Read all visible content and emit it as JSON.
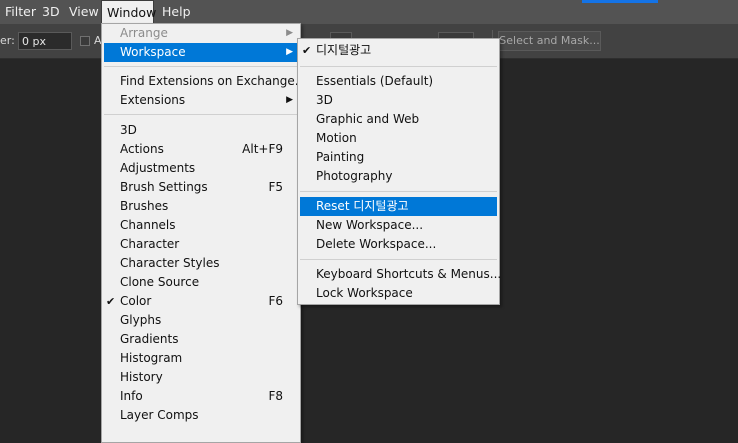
{
  "menubar": {
    "items": [
      "Filter",
      "3D",
      "View",
      "Window",
      "Help"
    ]
  },
  "options": {
    "feather_label": "er:",
    "feather_value": "0 px",
    "aa_label": "A",
    "select_mask_label": "Select and Mask..."
  },
  "window_menu": {
    "items": [
      {
        "label": "Arrange",
        "submenu": true,
        "disabled": true
      },
      {
        "label": "Workspace",
        "submenu": true,
        "highlighted": true
      },
      {
        "label": "Find Extensions on Exchange..."
      },
      {
        "label": "Extensions",
        "submenu": true
      },
      {
        "label": "3D"
      },
      {
        "label": "Actions",
        "shortcut": "Alt+F9"
      },
      {
        "label": "Adjustments"
      },
      {
        "label": "Brush Settings",
        "shortcut": "F5"
      },
      {
        "label": "Brushes"
      },
      {
        "label": "Channels"
      },
      {
        "label": "Character"
      },
      {
        "label": "Character Styles"
      },
      {
        "label": "Clone Source"
      },
      {
        "label": "Color",
        "shortcut": "F6",
        "checked": true
      },
      {
        "label": "Glyphs"
      },
      {
        "label": "Gradients"
      },
      {
        "label": "Histogram"
      },
      {
        "label": "History"
      },
      {
        "label": "Info",
        "shortcut": "F8"
      },
      {
        "label": "Layer Comps"
      }
    ]
  },
  "workspace_menu": {
    "items": [
      {
        "label": "디지털광고",
        "checked": true
      },
      {
        "label": "Essentials (Default)"
      },
      {
        "label": "3D"
      },
      {
        "label": "Graphic and Web"
      },
      {
        "label": "Motion"
      },
      {
        "label": "Painting"
      },
      {
        "label": "Photography"
      },
      {
        "label": "Reset 디지털광고",
        "highlighted": true
      },
      {
        "label": "New Workspace..."
      },
      {
        "label": "Delete Workspace..."
      },
      {
        "label": "Keyboard Shortcuts & Menus..."
      },
      {
        "label": "Lock Workspace"
      }
    ]
  },
  "glyphs": {
    "arrow": "▶",
    "check": "✔"
  },
  "colors": {
    "highlight": "#0078d7",
    "menubar": "#535353",
    "canvas": "#262626"
  }
}
